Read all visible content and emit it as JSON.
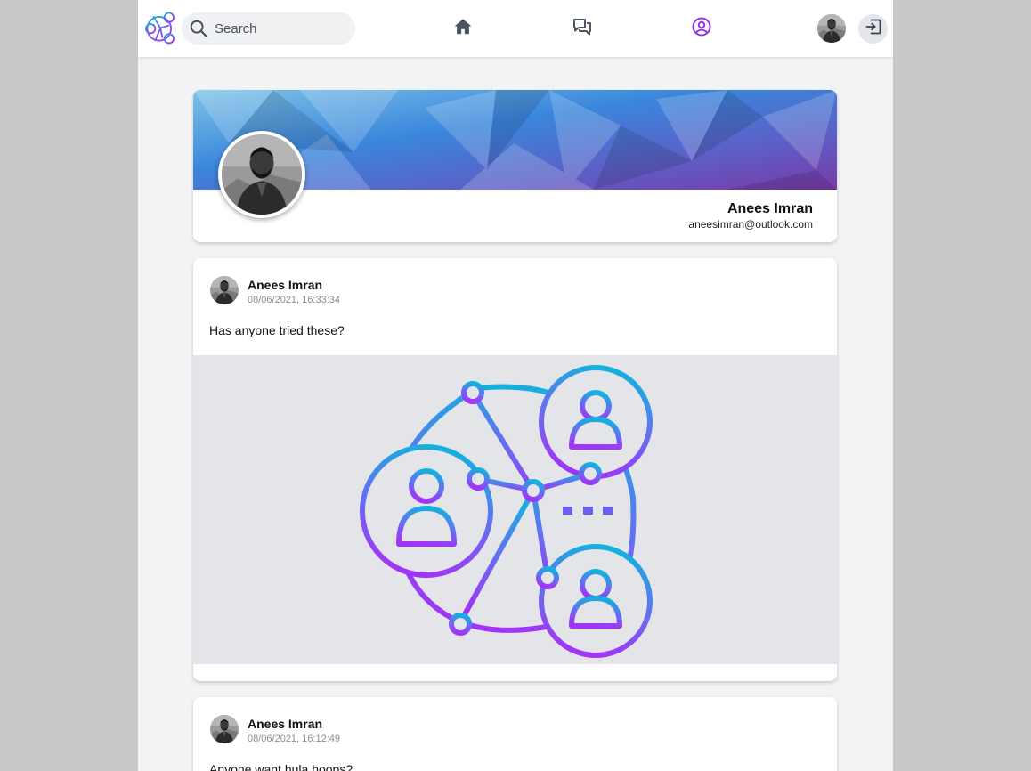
{
  "app": {
    "logo": "network-users-logo",
    "accent_color": "#9333ea"
  },
  "search": {
    "placeholder": "Search"
  },
  "nav": {
    "items": [
      {
        "icon": "home-icon",
        "active": false
      },
      {
        "icon": "chat-icon",
        "active": false
      },
      {
        "icon": "profile-icon",
        "active": true
      }
    ],
    "logout_icon": "logout-icon"
  },
  "profile": {
    "name": "Anees Imran",
    "email": "aneesimran@outlook.com"
  },
  "posts": [
    {
      "author": "Anees Imran",
      "timestamp": "08/06/2021, 16:33:34",
      "text": "Has anyone tried these?",
      "image": "social-network-illustration"
    },
    {
      "author": "Anees Imran",
      "timestamp": "08/06/2021, 16:12:49",
      "text": "Anyone want hula hoops?"
    }
  ]
}
